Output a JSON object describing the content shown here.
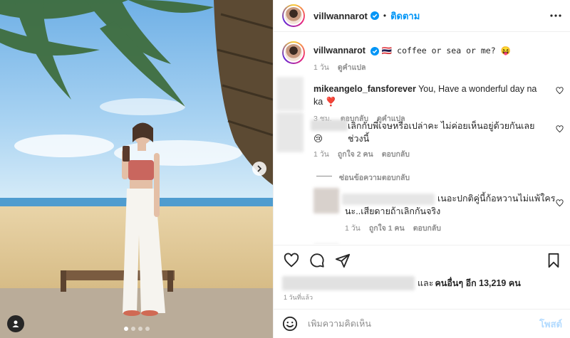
{
  "post": {
    "username": "villwannarot",
    "separator": "•",
    "follow_label": "ติดตาม"
  },
  "caption": {
    "username": "villwannarot",
    "text": "🇹🇭 coffee or sea or me? 😝",
    "age": "1 วัน",
    "translate": "ดูคำแปล"
  },
  "comments": [
    {
      "username": "mikeangelo_fansforever",
      "text": "You, Have a wonderful day na ka ❣️",
      "age": "3 ชม.",
      "reply": "ตอบกลับ",
      "translate": "ดูคำแปล"
    },
    {
      "text": "เลิกกับพี่เจษหรือเปล่าคะ ไม่ค่อยเห็นอยู่ด้วยกันเลยช่วงนี้",
      "emoji": "😢",
      "age": "1 วัน",
      "likes": "ถูกใจ 2 คน",
      "reply": "ตอบกลับ",
      "hide_replies": "ซ่อนข้อความตอบกลับ"
    },
    {
      "text_line1": "เนอะปกติคู่นี้ก้อหวานไม่แพ้ใคร",
      "text_line2": "นะ..เสียดายถ้าเลิกกันจริง",
      "age": "1 วัน",
      "likes": "ถูกใจ 1 คน",
      "reply": "ตอบกลับ"
    }
  ],
  "likes_summary": {
    "prefix": "และ",
    "others_label": "คนอื่นๆ อีก 13,219 คน"
  },
  "timestamp": "1 วันที่แล้ว",
  "add_comment": {
    "placeholder": "เพิ่มความคิดเห็น",
    "post_label": "โพสต์"
  },
  "icons": [
    "verified-icon",
    "more-icon",
    "heart-icon",
    "comment-icon",
    "share-icon",
    "bookmark-icon",
    "emoji-icon",
    "chevron-right-icon",
    "user-tag-icon"
  ],
  "colors": {
    "accent": "#0095f6",
    "text": "#262626",
    "muted": "#8e8e8e",
    "heart_red": "#ed4956"
  }
}
